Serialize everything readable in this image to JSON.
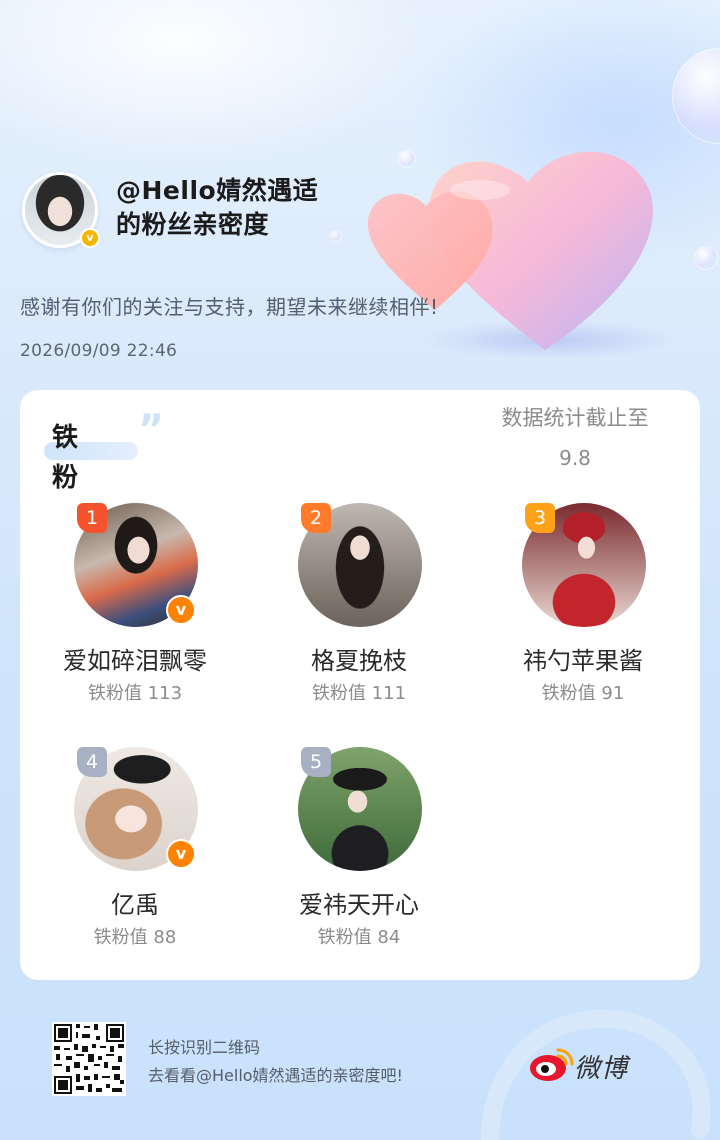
{
  "header": {
    "owner_line1": "@Hello婧然遇适",
    "owner_line2": "的粉丝亲密度",
    "verified_icon": "v-badge-icon",
    "thanks": "感谢有你们的关注与支持，期望未来继续相伴!",
    "date": "2026/09/09  22:46"
  },
  "card": {
    "badge_title": "铁粉",
    "stat_label": "数据统计截止至",
    "stat_date": "9.8",
    "fans": [
      {
        "rank": "1",
        "name": "爱如碎泪飘零",
        "value": "铁粉值 113",
        "verified": true,
        "rank_color": "#f5532d"
      },
      {
        "rank": "2",
        "name": "格夏挽枝",
        "value": "铁粉值 111",
        "verified": false,
        "rank_color": "#ff7a2b"
      },
      {
        "rank": "3",
        "name": "祎勺苹果酱",
        "value": "铁粉值 91",
        "verified": false,
        "rank_color": "#ffa21a"
      },
      {
        "rank": "4",
        "name": "亿禹",
        "value": "铁粉值 88",
        "verified": true,
        "rank_color": "#a8b0c4"
      },
      {
        "rank": "5",
        "name": "爱祎天开心",
        "value": "铁粉值 84",
        "verified": false,
        "rank_color": "#a8b0c4"
      }
    ]
  },
  "footer": {
    "line1": "长按识别二维码",
    "line2": "去看看@Hello婧然遇适的亲密度吧!",
    "brand": "微博",
    "qr_icon": "qr-code-icon",
    "logo_icon": "weibo-logo-icon"
  },
  "colors": {
    "verified_orange": "#ff8200",
    "verified_gold": "#f7b500",
    "accent_blue": "#cfe4fb"
  }
}
